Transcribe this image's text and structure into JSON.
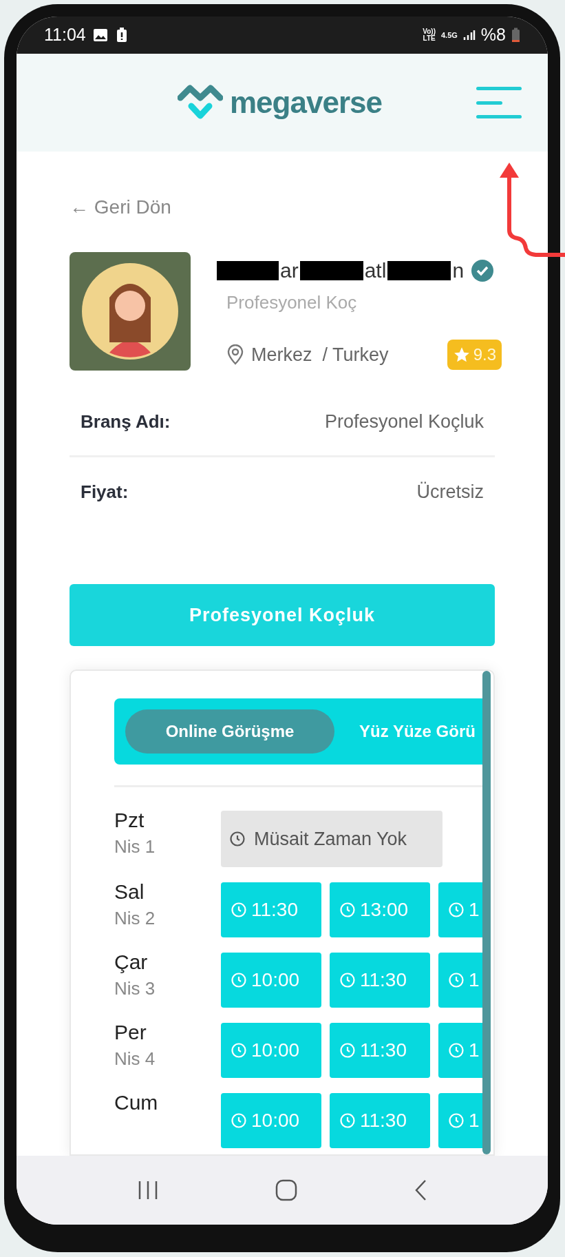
{
  "status_bar": {
    "time": "11:04",
    "volte": "Vo))",
    "lte": "LTE",
    "network": "4.5G",
    "battery": "%8"
  },
  "header": {
    "logo": "megaverse"
  },
  "back_link": "← Geri Dön",
  "profile": {
    "name_fragments": [
      "ar",
      "atl",
      "n"
    ],
    "verified": true,
    "title": "Profesyonel Koç",
    "location": "Merkez  / Turkey",
    "rating": "9.3"
  },
  "details": [
    {
      "label": "Branş Adı:",
      "value": "Profesyonel Koçluk"
    },
    {
      "label": "Fiyat:",
      "value": "Ücretsiz"
    }
  ],
  "primary_button": "Profesyonel Koçluk",
  "tabs": [
    {
      "label": "Online Görüşme",
      "selected": true
    },
    {
      "label": "Yüz Yüze Görü",
      "selected": false
    }
  ],
  "days": [
    {
      "day": "Pzt",
      "date": "Nis 1",
      "slots": [
        {
          "kind": "unavailable",
          "label": "Müsait Zaman Yok"
        }
      ]
    },
    {
      "day": "Sal",
      "date": "Nis 2",
      "slots": [
        {
          "kind": "time",
          "label": "11:30"
        },
        {
          "kind": "time",
          "label": "13:00"
        },
        {
          "kind": "time",
          "label": "1"
        }
      ]
    },
    {
      "day": "Çar",
      "date": "Nis 3",
      "slots": [
        {
          "kind": "time",
          "label": "10:00"
        },
        {
          "kind": "time",
          "label": "11:30"
        },
        {
          "kind": "time",
          "label": "1"
        }
      ]
    },
    {
      "day": "Per",
      "date": "Nis 4",
      "slots": [
        {
          "kind": "time",
          "label": "10:00"
        },
        {
          "kind": "time",
          "label": "11:30"
        },
        {
          "kind": "time",
          "label": "1"
        }
      ]
    },
    {
      "day": "Cum",
      "slots": [
        {
          "kind": "time",
          "label": "10:00"
        },
        {
          "kind": "time",
          "label": "11:30"
        },
        {
          "kind": "time",
          "label": "1"
        }
      ]
    }
  ]
}
